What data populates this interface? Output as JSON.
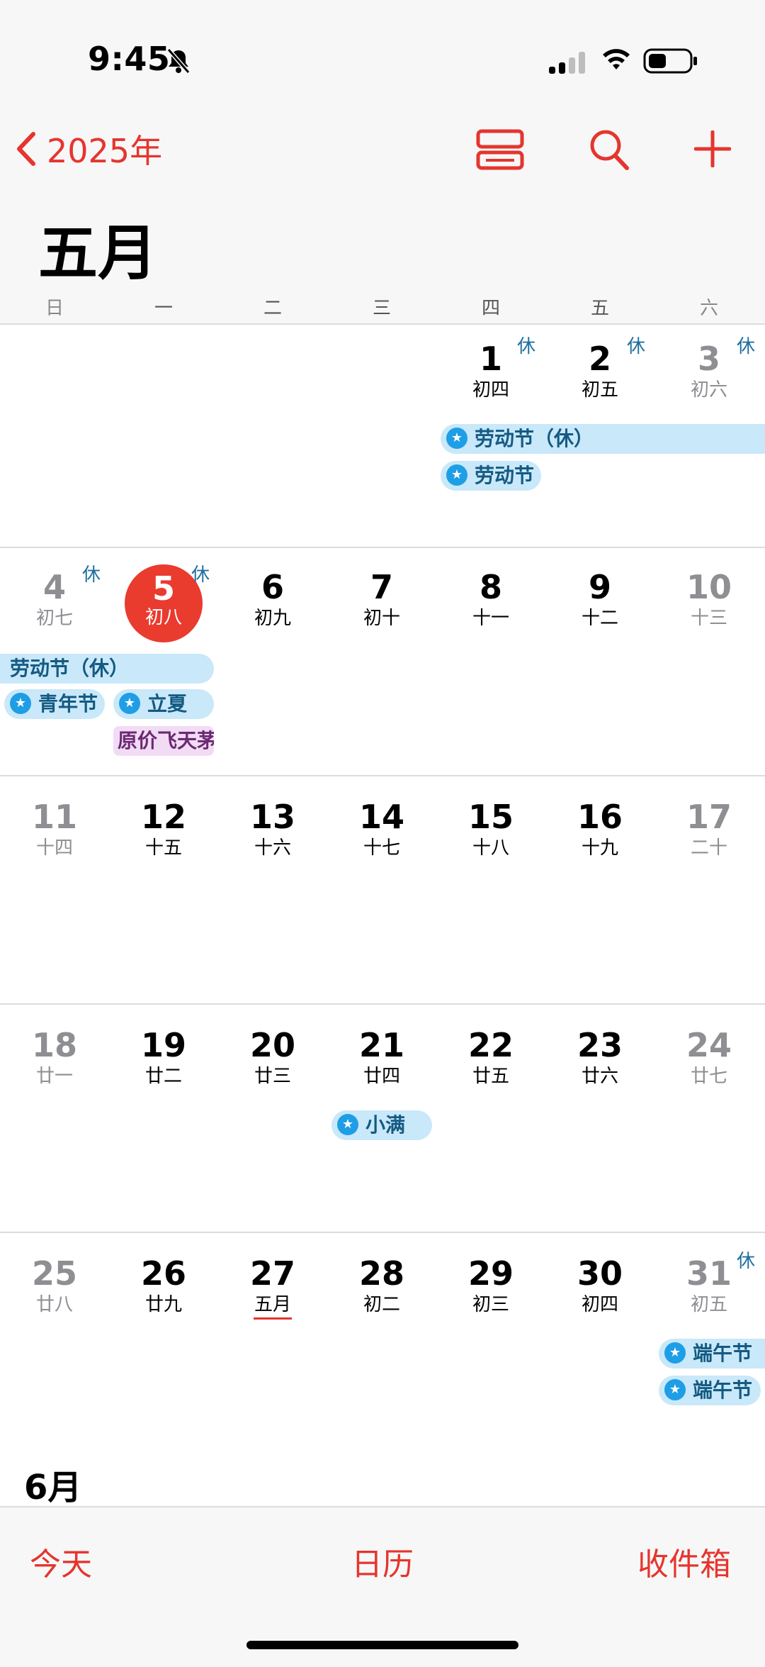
{
  "status_bar": {
    "time": "9:45"
  },
  "nav": {
    "back_label": "2025年"
  },
  "month": {
    "title": "五月"
  },
  "weekdays": [
    "日",
    "一",
    "二",
    "三",
    "四",
    "五",
    "六"
  ],
  "holiday_tag": "休",
  "weeks": [
    {
      "days": [
        null,
        null,
        null,
        null,
        {
          "num": "1",
          "lunar": "初四",
          "tag": "休"
        },
        {
          "num": "2",
          "lunar": "初五",
          "tag": "休"
        },
        {
          "num": "3",
          "lunar": "初六",
          "tag": "休"
        }
      ]
    },
    {
      "days": [
        {
          "num": "4",
          "lunar": "初七",
          "tag": "休"
        },
        {
          "num": "5",
          "lunar": "初八",
          "tag": "休",
          "today": true
        },
        {
          "num": "6",
          "lunar": "初九"
        },
        {
          "num": "7",
          "lunar": "初十"
        },
        {
          "num": "8",
          "lunar": "十一"
        },
        {
          "num": "9",
          "lunar": "十二"
        },
        {
          "num": "10",
          "lunar": "十三"
        }
      ]
    },
    {
      "days": [
        {
          "num": "11",
          "lunar": "十四"
        },
        {
          "num": "12",
          "lunar": "十五"
        },
        {
          "num": "13",
          "lunar": "十六"
        },
        {
          "num": "14",
          "lunar": "十七"
        },
        {
          "num": "15",
          "lunar": "十八"
        },
        {
          "num": "16",
          "lunar": "十九"
        },
        {
          "num": "17",
          "lunar": "二十"
        }
      ]
    },
    {
      "days": [
        {
          "num": "18",
          "lunar": "廿一"
        },
        {
          "num": "19",
          "lunar": "廿二"
        },
        {
          "num": "20",
          "lunar": "廿三"
        },
        {
          "num": "21",
          "lunar": "廿四"
        },
        {
          "num": "22",
          "lunar": "廿五"
        },
        {
          "num": "23",
          "lunar": "廿六"
        },
        {
          "num": "24",
          "lunar": "廿七"
        }
      ]
    },
    {
      "days": [
        {
          "num": "25",
          "lunar": "廿八"
        },
        {
          "num": "26",
          "lunar": "廿九"
        },
        {
          "num": "27",
          "lunar": "五月"
        },
        {
          "num": "28",
          "lunar": "初二"
        },
        {
          "num": "29",
          "lunar": "初三"
        },
        {
          "num": "30",
          "lunar": "初四"
        },
        {
          "num": "31",
          "lunar": "初五",
          "tag": "休"
        }
      ]
    }
  ],
  "events": {
    "laodong_rest": "劳动节（休）",
    "laodong": "劳动节",
    "laodong_rest2": "劳动节（休）",
    "qingnian": "青年节",
    "lixia": "立夏",
    "yuanjia": "原价飞天茅",
    "xiaoman": "小满",
    "duanwu_rest": "端午节",
    "duanwu": "端午节"
  },
  "next_month": "6月",
  "tabs": {
    "today": "今天",
    "calendars": "日历",
    "inbox": "收件箱"
  },
  "colors": {
    "accent": "#e5352e",
    "event_bg": "#c9e8f9",
    "event_text": "#145a82",
    "holiday_tag": "#1f6f9f"
  }
}
